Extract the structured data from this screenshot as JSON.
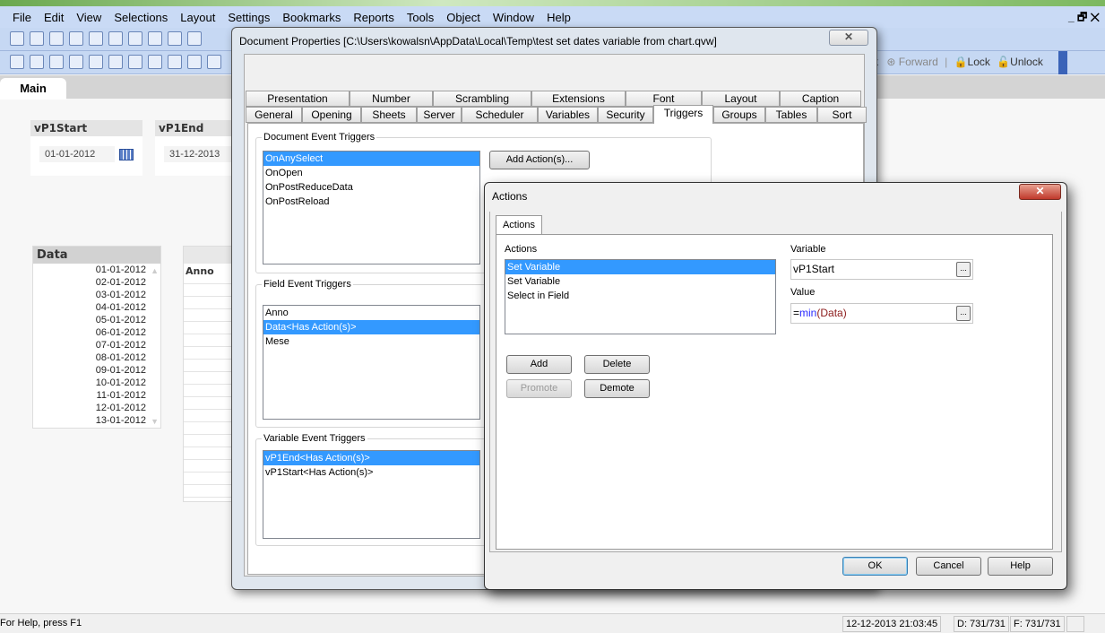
{
  "menu": [
    "File",
    "Edit",
    "View",
    "Selections",
    "Layout",
    "Settings",
    "Bookmarks",
    "Reports",
    "Tools",
    "Object",
    "Window",
    "Help"
  ],
  "toolbar2_right": {
    "back_partial": "ck",
    "forward": "Forward",
    "lock": "Lock",
    "unlock": "Unlock"
  },
  "sheet_tab": "Main",
  "sheet": {
    "vstart": {
      "title": "vP1Start",
      "value": "01-01-2012"
    },
    "vend": {
      "title": "vP1End",
      "value": "31-12-2013"
    },
    "data_list": {
      "title": "Data",
      "items": [
        "01-01-2012",
        "02-01-2012",
        "03-01-2012",
        "04-01-2012",
        "05-01-2012",
        "06-01-2012",
        "07-01-2012",
        "08-01-2012",
        "09-01-2012",
        "10-01-2012",
        "11-01-2012",
        "12-01-2012",
        "13-01-2012"
      ]
    },
    "table": {
      "header": "Anno"
    }
  },
  "docprops": {
    "title": "Document Properties [C:\\Users\\kowalsn\\AppData\\Local\\Temp\\test set dates variable from chart.qvw]",
    "tabs_row1": [
      "Presentation",
      "Number",
      "Scrambling",
      "Extensions",
      "Font",
      "Layout",
      "Caption"
    ],
    "tabs_row2": [
      "General",
      "Opening",
      "Sheets",
      "Server",
      "Scheduler",
      "Variables",
      "Security",
      "Triggers",
      "Groups",
      "Tables",
      "Sort"
    ],
    "active_tab": "Triggers",
    "doc_group": {
      "label": "Document Event Triggers",
      "items": [
        "OnAnySelect",
        "OnOpen",
        "OnPostReduceData",
        "OnPostReload"
      ],
      "add_button": "Add Action(s)..."
    },
    "field_group": {
      "label": "Field Event Triggers",
      "items": [
        "Anno",
        "Data<Has Action(s)>",
        "Mese"
      ]
    },
    "var_group": {
      "label": "Variable Event Triggers",
      "items": [
        "vP1End<Has Action(s)>",
        "vP1Start<Has Action(s)>"
      ]
    }
  },
  "actions": {
    "title": "Actions",
    "tab": "Actions",
    "list_label": "Actions",
    "items": [
      "Set Variable",
      "Set Variable",
      "Select in Field"
    ],
    "variable_label": "Variable",
    "variable_value": "vP1Start",
    "value_label": "Value",
    "value_eq": "=",
    "value_fn": "min",
    "value_arg": "(Data)",
    "browse": "...",
    "buttons": {
      "add": "Add",
      "delete": "Delete",
      "promote": "Promote",
      "demote": "Demote",
      "ok": "OK",
      "cancel": "Cancel",
      "help": "Help"
    }
  },
  "status": {
    "help": "For Help, press F1",
    "datetime": "12-12-2013 21:03:45",
    "d": "D: 731/731",
    "f": "F: 731/731"
  }
}
